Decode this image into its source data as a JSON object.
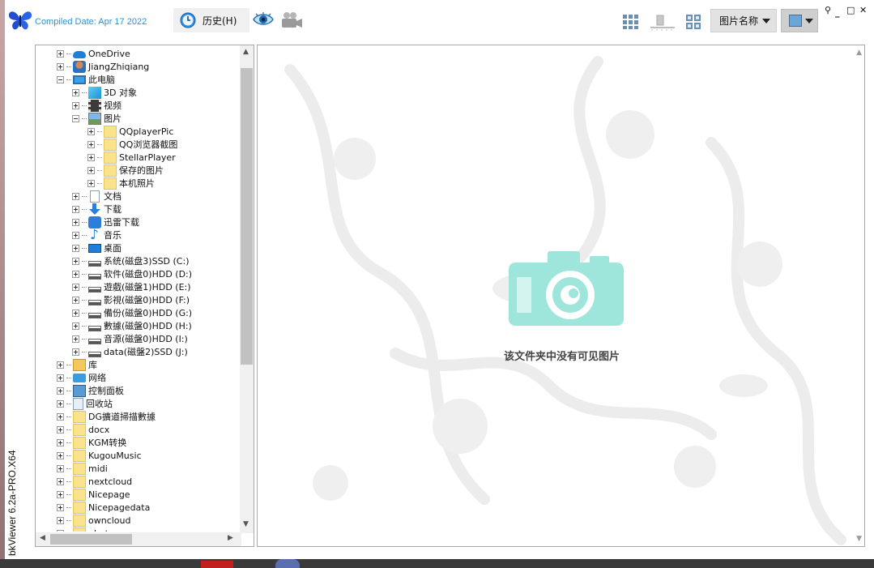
{
  "app": {
    "compiled": "Compiled Date: Apr 17 2022",
    "version": "bkViewer 6.2a-PRO.X64"
  },
  "toolbar": {
    "history_label": "历史(H)",
    "sort_label": "图片名称",
    "win_controls": [
      "pin",
      "minimize",
      "maximize",
      "close"
    ]
  },
  "tree": {
    "items": [
      {
        "label": "OneDrive",
        "icon": "cloud-icon",
        "level": 0,
        "expander": "plus"
      },
      {
        "label": "JiangZhiqiang",
        "icon": "user-icon",
        "level": 0,
        "expander": "plus"
      },
      {
        "label": "此电脑",
        "icon": "pc-icon",
        "level": 0,
        "expander": "minus"
      },
      {
        "label": "3D 对象",
        "icon": "cube-icon",
        "level": 1,
        "expander": "plus"
      },
      {
        "label": "视频",
        "icon": "film-icon",
        "level": 1,
        "expander": "plus"
      },
      {
        "label": "图片",
        "icon": "image-icon",
        "level": 1,
        "expander": "minus"
      },
      {
        "label": "QQplayerPic",
        "icon": "folder-icon",
        "level": 2,
        "expander": "plus"
      },
      {
        "label": "QQ浏览器截图",
        "icon": "folder-icon",
        "level": 2,
        "expander": "plus"
      },
      {
        "label": "StellarPlayer",
        "icon": "folder-icon",
        "level": 2,
        "expander": "plus"
      },
      {
        "label": "保存的图片",
        "icon": "folder-icon",
        "level": 2,
        "expander": "plus"
      },
      {
        "label": "本机照片",
        "icon": "folder-icon",
        "level": 2,
        "expander": "plus"
      },
      {
        "label": "文档",
        "icon": "doc-icon",
        "level": 1,
        "expander": "plus"
      },
      {
        "label": "下载",
        "icon": "download-icon",
        "level": 1,
        "expander": "plus"
      },
      {
        "label": "迅雷下载",
        "icon": "xunlei-icon",
        "level": 1,
        "expander": "plus"
      },
      {
        "label": "音乐",
        "icon": "music-icon",
        "level": 1,
        "expander": "plus"
      },
      {
        "label": "桌面",
        "icon": "desktop-icon",
        "level": 1,
        "expander": "plus"
      },
      {
        "label": "系统(磁盘3)SSD (C:)",
        "icon": "drive-icon",
        "level": 1,
        "expander": "plus"
      },
      {
        "label": "软件(磁盘0)HDD (D:)",
        "icon": "drive-icon",
        "level": 1,
        "expander": "plus"
      },
      {
        "label": "遊戲(磁盤1)HDD (E:)",
        "icon": "drive-icon",
        "level": 1,
        "expander": "plus"
      },
      {
        "label": "影視(磁盤0)HDD (F:)",
        "icon": "drive-icon",
        "level": 1,
        "expander": "plus"
      },
      {
        "label": "備份(磁盤0)HDD (G:)",
        "icon": "drive-icon",
        "level": 1,
        "expander": "plus"
      },
      {
        "label": "數據(磁盤0)HDD (H:)",
        "icon": "drive-icon",
        "level": 1,
        "expander": "plus"
      },
      {
        "label": "音源(磁盤0)HDD (I:)",
        "icon": "drive-icon",
        "level": 1,
        "expander": "plus"
      },
      {
        "label": "data(磁盤2)SSD (J:)",
        "icon": "drive-icon",
        "level": 1,
        "expander": "plus"
      },
      {
        "label": "库",
        "icon": "library-icon",
        "level": 0,
        "expander": "plus"
      },
      {
        "label": "网络",
        "icon": "network-icon",
        "level": 0,
        "expander": "plus"
      },
      {
        "label": "控制面板",
        "icon": "control-panel-icon",
        "level": 0,
        "expander": "plus"
      },
      {
        "label": "回收站",
        "icon": "recycle-bin-icon",
        "level": 0,
        "expander": "plus"
      },
      {
        "label": "DG擴道掃描數據",
        "icon": "folder-icon",
        "level": 0,
        "expander": "plus"
      },
      {
        "label": "docx",
        "icon": "folder-icon",
        "level": 0,
        "expander": "plus"
      },
      {
        "label": "KGM转换",
        "icon": "folder-icon",
        "level": 0,
        "expander": "plus"
      },
      {
        "label": "KugouMusic",
        "icon": "folder-icon",
        "level": 0,
        "expander": "plus"
      },
      {
        "label": "midi",
        "icon": "folder-icon",
        "level": 0,
        "expander": "plus"
      },
      {
        "label": "nextcloud",
        "icon": "folder-icon",
        "level": 0,
        "expander": "plus"
      },
      {
        "label": "Nicepage",
        "icon": "folder-icon",
        "level": 0,
        "expander": "plus"
      },
      {
        "label": "Nicepagedata",
        "icon": "folder-icon",
        "level": 0,
        "expander": "plus"
      },
      {
        "label": "owncloud",
        "icon": "folder-icon",
        "level": 0,
        "expander": "plus"
      },
      {
        "label": "photo",
        "icon": "folder-icon",
        "level": 0,
        "expander": "plus"
      }
    ]
  },
  "viewer": {
    "empty_message": "该文件夹中没有可见图片"
  },
  "colors": {
    "accent": "#2a93d5",
    "camera": "#9ee6dc",
    "watermark": "#ececec"
  }
}
